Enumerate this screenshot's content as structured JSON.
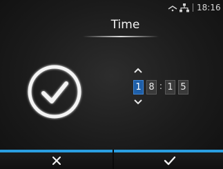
{
  "status_bar": {
    "time": "18:16",
    "icons": [
      "wifi-icon",
      "network-icon"
    ]
  },
  "screen": {
    "title": "Time",
    "main_icon": "clock-check-icon"
  },
  "time_editor": {
    "digits": [
      "1",
      "8",
      "1",
      "5"
    ],
    "selected_index": 0,
    "separator": ":"
  },
  "softkeys": {
    "cancel_icon": "close-icon",
    "ok_icon": "check-icon"
  },
  "colors": {
    "accent": "#2a9ee0",
    "selected_digit": "#1f5fa8"
  }
}
